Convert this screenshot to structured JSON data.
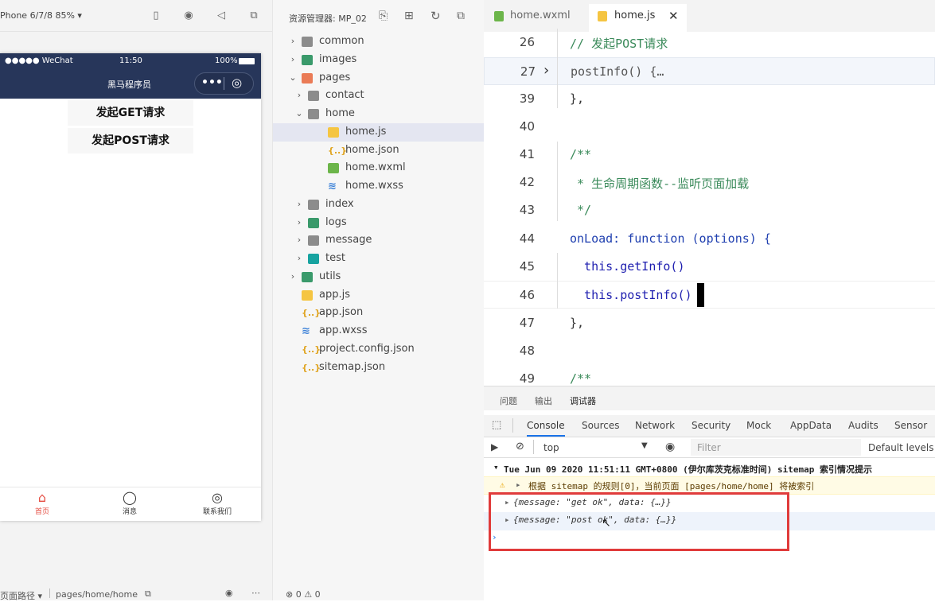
{
  "simulator": {
    "device": "Phone 6/7/8 85% ▾",
    "status_carrier": "●●●●● WeChat",
    "status_time": "11:50",
    "status_battery": "100%",
    "nav_title": "黑马程序员",
    "capsule_more": "•••",
    "capsule_close": "◎",
    "buttons": [
      "发起GET请求",
      "发起POST请求"
    ],
    "tabs": [
      {
        "label": "首页",
        "icon": "home-icon",
        "active": true
      },
      {
        "label": "消息",
        "icon": "message-icon",
        "active": false
      },
      {
        "label": "联系我们",
        "icon": "phone-icon",
        "active": false
      }
    ],
    "bottom_path_label": "页面路径 ▾",
    "bottom_path": "pages/home/home"
  },
  "explorer": {
    "title": "资源管理器: MP_02",
    "items": [
      {
        "label": "common",
        "type": "folder",
        "color": "gray",
        "expanded": false,
        "depth": 0
      },
      {
        "label": "images",
        "type": "folder",
        "color": "green",
        "expanded": false,
        "depth": 0
      },
      {
        "label": "pages",
        "type": "folder",
        "color": "orange",
        "expanded": true,
        "depth": 0
      },
      {
        "label": "contact",
        "type": "folder",
        "color": "gray",
        "expanded": false,
        "depth": 1
      },
      {
        "label": "home",
        "type": "folder",
        "color": "gray",
        "expanded": true,
        "depth": 1
      },
      {
        "label": "home.js",
        "type": "js",
        "depth": 2,
        "selected": true
      },
      {
        "label": "home.json",
        "type": "json",
        "depth": 2
      },
      {
        "label": "home.wxml",
        "type": "wxml",
        "depth": 2
      },
      {
        "label": "home.wxss",
        "type": "wxss",
        "depth": 2
      },
      {
        "label": "index",
        "type": "folder",
        "color": "gray",
        "expanded": false,
        "depth": 1
      },
      {
        "label": "logs",
        "type": "folder",
        "color": "green",
        "expanded": false,
        "depth": 1
      },
      {
        "label": "message",
        "type": "folder",
        "color": "gray",
        "expanded": false,
        "depth": 1
      },
      {
        "label": "test",
        "type": "folder",
        "color": "teal",
        "expanded": false,
        "depth": 1
      },
      {
        "label": "utils",
        "type": "folder",
        "color": "green",
        "expanded": false,
        "depth": 0
      },
      {
        "label": "app.js",
        "type": "js",
        "depth": 0
      },
      {
        "label": "app.json",
        "type": "json",
        "depth": 0
      },
      {
        "label": "app.wxss",
        "type": "wxss",
        "depth": 0
      },
      {
        "label": "project.config.json",
        "type": "json",
        "depth": 0
      },
      {
        "label": "sitemap.json",
        "type": "json",
        "depth": 0
      }
    ],
    "status": "⊗ 0 ⚠ 0"
  },
  "editor": {
    "tabs": [
      {
        "label": "home.wxml",
        "active": false
      },
      {
        "label": "home.js",
        "active": true
      }
    ],
    "lines": [
      {
        "num": "26",
        "text": "// 发起POST请求"
      },
      {
        "num": "27",
        "text": "postInfo() {…"
      },
      {
        "num": "39",
        "text": "},"
      },
      {
        "num": "40",
        "text": ""
      },
      {
        "num": "41",
        "text": "/**"
      },
      {
        "num": "42",
        "text": " * 生命周期函数--监听页面加载"
      },
      {
        "num": "43",
        "text": " */"
      },
      {
        "num": "44",
        "text": "onLoad: function (options) {"
      },
      {
        "num": "45",
        "text": "  this.getInfo()"
      },
      {
        "num": "46",
        "text": "  this.postInfo()"
      },
      {
        "num": "47",
        "text": "},"
      },
      {
        "num": "48",
        "text": ""
      },
      {
        "num": "49",
        "text": "/**"
      }
    ]
  },
  "panel": {
    "tabs": [
      "问题",
      "输出",
      "调试器"
    ],
    "devtools_tabs": [
      "Console",
      "Sources",
      "Network",
      "Security",
      "Mock",
      "AppData",
      "Audits",
      "Sensor"
    ],
    "context": "top",
    "filter_placeholder": "Filter",
    "levels": "Default levels ▾",
    "logs": {
      "group": "Tue Jun 09 2020 11:51:11 GMT+0800 (伊尔库茨克标准时间) sitemap 索引情况提示",
      "warning": "根据 sitemap 的规则[0]，当前页面 [pages/home/home] 将被索引",
      "obj1": "{message: \"get ok\", data: {…}}",
      "obj2": "{message: \"post ok\", data: {…}}",
      "prompt": "›"
    }
  }
}
